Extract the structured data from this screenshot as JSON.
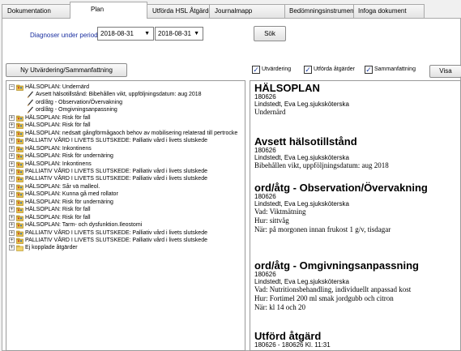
{
  "tabs": [
    {
      "label": "Dokumentation"
    },
    {
      "label": "Plan"
    },
    {
      "label": "Utförda HSL Åtgärder"
    },
    {
      "label": "Journalmapp"
    },
    {
      "label": "Bedömningsinstrument"
    },
    {
      "label": "Infoga dokument"
    }
  ],
  "toolbar": {
    "diag_label": "Diagnoser under perioden",
    "date_from": "2018-08-31",
    "date_to": "2018-08-31",
    "search_label": "Sök",
    "new_eval_label": "Ny Utvärdering/Sammanfattning"
  },
  "tree": [
    {
      "level": 0,
      "expander": "−",
      "icon": "folder-people-icon",
      "label": "HÄLSOPLAN: Undernärd"
    },
    {
      "level": 1,
      "expander": "",
      "icon": "pencil-icon",
      "label": "Avsett hälsotillstånd: Bibehållen vikt, uppföljningsdatum: aug 2018"
    },
    {
      "level": 1,
      "expander": "",
      "icon": "pencil-icon",
      "label": "ord/åtg - Observation/Övervakning"
    },
    {
      "level": 1,
      "expander": "",
      "icon": "pencil-icon",
      "label": "ord/åtg - Omgivningsanpassning"
    },
    {
      "level": 0,
      "expander": "+",
      "icon": "folder-people-icon",
      "label": "HÄLSOPLAN: Risk för fall"
    },
    {
      "level": 0,
      "expander": "+",
      "icon": "folder-people-icon",
      "label": "HÄLSOPLAN: Risk för fall"
    },
    {
      "level": 0,
      "expander": "+",
      "icon": "folder-people-icon",
      "label": "HÄLSOPLAN: nedsatt gångförmågaoch behov av mobilisering relaterad till pertrocke"
    },
    {
      "level": 0,
      "expander": "+",
      "icon": "folder-people-icon",
      "label": "PALLIATIV VÅRD I LIVETS SLUTSKEDE: Palliativ vård i livets slutskede"
    },
    {
      "level": 0,
      "expander": "+",
      "icon": "folder-people-icon",
      "label": "HÄLSOPLAN: Inkontinens"
    },
    {
      "level": 0,
      "expander": "+",
      "icon": "folder-people-icon",
      "label": "HÄLSOPLAN: Risk för undernäring"
    },
    {
      "level": 0,
      "expander": "+",
      "icon": "folder-people-icon",
      "label": "HÄLSOPLAN: Inkontinens"
    },
    {
      "level": 0,
      "expander": "+",
      "icon": "folder-people-icon",
      "label": "PALLIATIV VÅRD I LIVETS SLUTSKEDE: Palliativ vård i livets slutskede"
    },
    {
      "level": 0,
      "expander": "+",
      "icon": "folder-people-icon",
      "label": "PALLIATIV VÅRD I LIVETS SLUTSKEDE: Palliativ vård i livets slutskede"
    },
    {
      "level": 0,
      "expander": "+",
      "icon": "folder-people-icon",
      "label": "HÄLSOPLAN: Sår vä malleol."
    },
    {
      "level": 0,
      "expander": "+",
      "icon": "folder-people-icon",
      "label": "HÄLSOPLAN: Kunna gå med rollator"
    },
    {
      "level": 0,
      "expander": "+",
      "icon": "folder-people-icon",
      "label": "HÄLSOPLAN: Risk för undernäring"
    },
    {
      "level": 0,
      "expander": "+",
      "icon": "folder-people-icon",
      "label": "HÄLSOPLAN: Risk för fall"
    },
    {
      "level": 0,
      "expander": "+",
      "icon": "folder-people-icon",
      "label": "HÄLSOPLAN: Risk för fall"
    },
    {
      "level": 0,
      "expander": "+",
      "icon": "folder-people-icon",
      "label": "HÄLSOPLAN: Tarm- och dysfunktion.Ileostomi"
    },
    {
      "level": 0,
      "expander": "+",
      "icon": "folder-people-icon",
      "label": "PALLIATIV VÅRD I LIVETS SLUTSKEDE: Palliativ vård i livets slutskede"
    },
    {
      "level": 0,
      "expander": "+",
      "icon": "folder-people-icon",
      "label": "PALLIATIV VÅRD I LIVETS SLUTSKEDE: Palliativ vård i livets slutskede"
    },
    {
      "level": 0,
      "expander": "+",
      "icon": "folder-icon",
      "label": "Ej kopplade åtgärder"
    }
  ],
  "filters": [
    {
      "label": "Utvärdering",
      "checked": true
    },
    {
      "label": "Utförda åtgärder",
      "checked": true
    },
    {
      "label": "Sammanfattning",
      "checked": true
    }
  ],
  "show_label": "Visa",
  "report": [
    {
      "heading": "HÄLSOPLAN",
      "date": "180626",
      "author": "Lindstedt, Eva   Leg.sjuksköterska",
      "lines": [
        "Undernärd"
      ]
    },
    {
      "heading": "Avsett hälsotillstånd",
      "date": "180626",
      "author": "Lindstedt, Eva   Leg.sjuksköterska",
      "lines": [
        "Bibehållen vikt, uppföljningsdatum: aug 2018"
      ]
    },
    {
      "heading": "ord/åtg - Observation/Övervakning",
      "date": "180626",
      "author": "Lindstedt, Eva   Leg.sjuksköterska",
      "lines": [
        "Vad: Viktmätning",
        "Hur: sittvåg",
        "När: på morgonen innan frukost 1 g/v, tisdagar"
      ]
    },
    {
      "heading": "ord/åtg - Omgivningsanpassning",
      "date": "180626",
      "author": "Lindstedt, Eva   Leg.sjuksköterska",
      "lines": [
        "Vad: Nutritionsbehandling, individuellt anpassad kost",
        "Hur: Fortimel 200 ml smak jordgubb och citron",
        "När: kl 14 och 20"
      ]
    },
    {
      "heading": "Utförd åtgärd",
      "date": "180626 - 180626  Kl. 11:31",
      "author": "",
      "lines": []
    }
  ]
}
